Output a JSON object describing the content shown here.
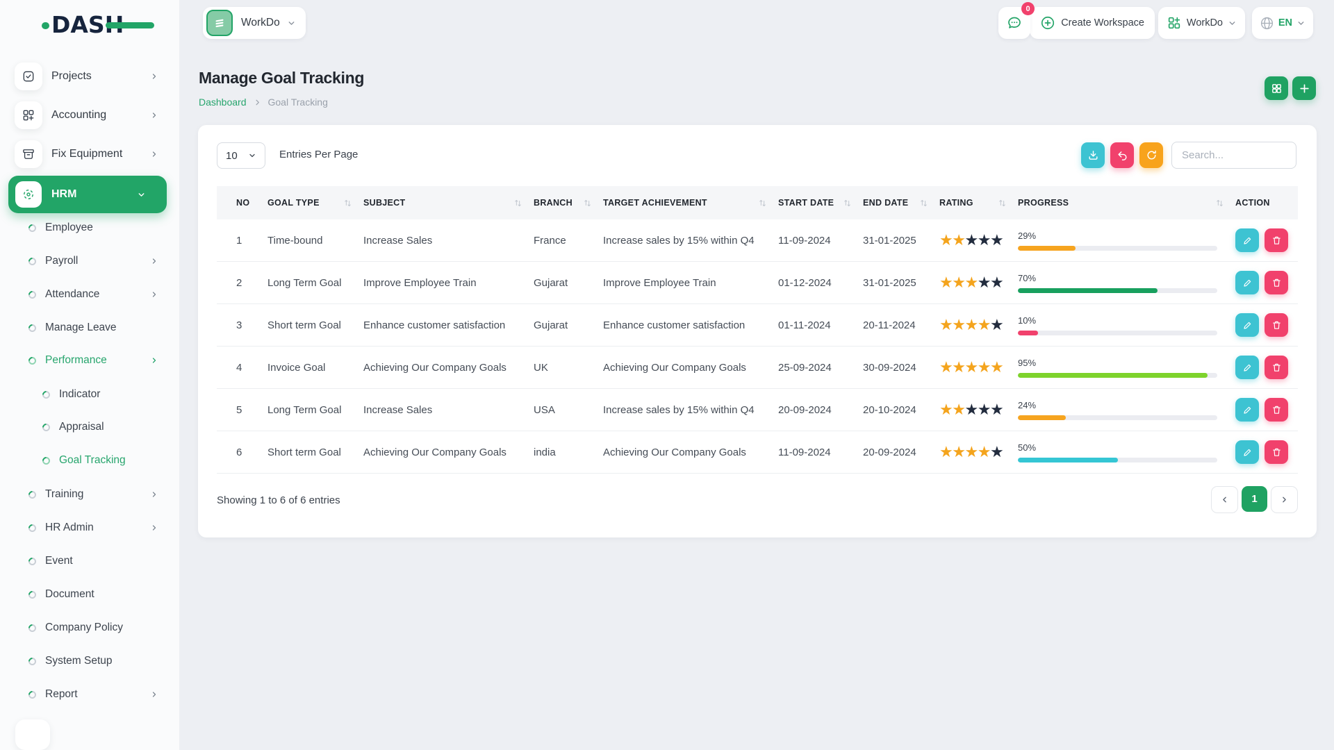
{
  "brand": {
    "name": "DASH",
    "accent_green": "#22a567",
    "navy": "#16243d"
  },
  "sidebar": {
    "items": [
      {
        "label": "Projects",
        "type": "parent",
        "icon": "tasks-icon",
        "chevron": "right"
      },
      {
        "label": "Accounting",
        "type": "parent",
        "icon": "grid-plus-icon",
        "chevron": "right"
      },
      {
        "label": "Fix Equipment",
        "type": "parent",
        "icon": "archive-icon",
        "chevron": "right"
      },
      {
        "label": "HRM",
        "type": "parent",
        "icon": "hub-icon",
        "chevron": "down",
        "active": true
      },
      {
        "label": "Employee",
        "type": "sub"
      },
      {
        "label": "Payroll",
        "type": "sub",
        "chevron": "right"
      },
      {
        "label": "Attendance",
        "type": "sub",
        "chevron": "right"
      },
      {
        "label": "Manage Leave",
        "type": "sub"
      },
      {
        "label": "Performance",
        "type": "sub",
        "chevron": "right",
        "active": true
      },
      {
        "label": "Indicator",
        "type": "subsub"
      },
      {
        "label": "Appraisal",
        "type": "subsub"
      },
      {
        "label": "Goal Tracking",
        "type": "subsub",
        "active": true
      },
      {
        "label": "Training",
        "type": "sub",
        "chevron": "right"
      },
      {
        "label": "HR Admin",
        "type": "sub",
        "chevron": "right"
      },
      {
        "label": "Event",
        "type": "sub"
      },
      {
        "label": "Document",
        "type": "sub"
      },
      {
        "label": "Company Policy",
        "type": "sub"
      },
      {
        "label": "System Setup",
        "type": "sub"
      },
      {
        "label": "Report",
        "type": "sub",
        "chevron": "right"
      }
    ]
  },
  "topbar": {
    "workspace_selector_label": "WorkDo",
    "chat_badge": "0",
    "create_workspace_label": "Create Workspace",
    "workspace_menu_label": "WorkDo",
    "language": "EN"
  },
  "page": {
    "title": "Manage Goal Tracking",
    "breadcrumb_home": "Dashboard",
    "breadcrumb_current": "Goal Tracking"
  },
  "toolbar": {
    "entries_value": "10",
    "entries_label": "Entries Per Page",
    "search_placeholder": "Search..."
  },
  "table": {
    "columns": [
      {
        "label": "NO",
        "sortable": false
      },
      {
        "label": "GOAL TYPE",
        "sortable": true
      },
      {
        "label": "SUBJECT",
        "sortable": true
      },
      {
        "label": "BRANCH",
        "sortable": true
      },
      {
        "label": "TARGET ACHIEVEMENT",
        "sortable": true
      },
      {
        "label": "START DATE",
        "sortable": true
      },
      {
        "label": "END DATE",
        "sortable": true
      },
      {
        "label": "RATING",
        "sortable": true
      },
      {
        "label": "PROGRESS",
        "sortable": true
      },
      {
        "label": "ACTION",
        "sortable": false
      }
    ],
    "rows": [
      {
        "no": "1",
        "goal_type": "Time-bound",
        "subject": "Increase Sales",
        "branch": "France",
        "target": "Increase sales by 15% within Q4",
        "start_date": "11-09-2024",
        "end_date": "31-01-2025",
        "rating": 2,
        "progress_pct": "29%",
        "progress_value": 29,
        "progress_color": "#f6a41f"
      },
      {
        "no": "2",
        "goal_type": "Long Term Goal",
        "subject": "Improve Employee Train",
        "branch": "Gujarat",
        "target": "Improve Employee Train",
        "start_date": "01-12-2024",
        "end_date": "31-01-2025",
        "rating": 3,
        "progress_pct": "70%",
        "progress_value": 70,
        "progress_color": "#18a05e"
      },
      {
        "no": "3",
        "goal_type": "Short term Goal",
        "subject": "Enhance customer satisfaction",
        "branch": "Gujarat",
        "target": "Enhance customer satisfaction",
        "start_date": "01-11-2024",
        "end_date": "20-11-2024",
        "rating": 4,
        "progress_pct": "10%",
        "progress_value": 10,
        "progress_color": "#f1416c"
      },
      {
        "no": "4",
        "goal_type": "Invoice Goal",
        "subject": "Achieving Our Company Goals",
        "branch": "UK",
        "target": "Achieving Our Company Goals",
        "start_date": "25-09-2024",
        "end_date": "30-09-2024",
        "rating": 5,
        "progress_pct": "95%",
        "progress_value": 95,
        "progress_color": "#7ed32c"
      },
      {
        "no": "5",
        "goal_type": "Long Term Goal",
        "subject": "Increase Sales",
        "branch": "USA",
        "target": "Increase sales by 15% within Q4",
        "start_date": "20-09-2024",
        "end_date": "20-10-2024",
        "rating": 2,
        "progress_pct": "24%",
        "progress_value": 24,
        "progress_color": "#f6a41f"
      },
      {
        "no": "6",
        "goal_type": "Short term Goal",
        "subject": "Achieving Our Company Goals",
        "branch": "india",
        "target": "Achieving Our Company Goals",
        "start_date": "11-09-2024",
        "end_date": "20-09-2024",
        "rating": 4,
        "progress_pct": "50%",
        "progress_value": 50,
        "progress_color": "#35c6d4"
      }
    ],
    "star_filled_color": "#f4a41d",
    "star_empty_color": "#222c3e"
  },
  "footer": {
    "summary": "Showing 1 to 6 of 6 entries",
    "active_page": "1"
  }
}
